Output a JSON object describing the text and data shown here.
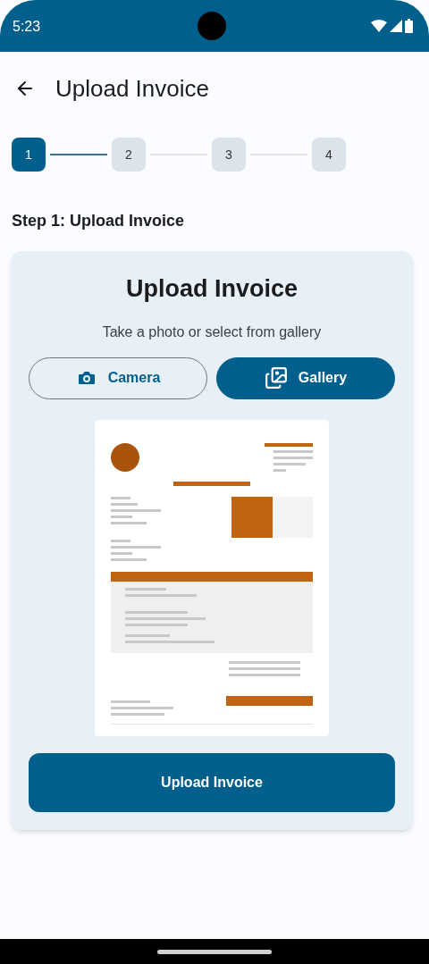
{
  "status_bar": {
    "time": "5:23"
  },
  "app_bar": {
    "title": "Upload Invoice"
  },
  "stepper": [
    {
      "label": "1",
      "selected": true
    },
    {
      "label": "2",
      "selected": false
    },
    {
      "label": "3",
      "selected": false
    },
    {
      "label": "4",
      "selected": false
    }
  ],
  "step_heading": "Step 1: Upload Invoice",
  "card": {
    "title": "Upload Invoice",
    "subtitle": "Take a photo or select from gallery",
    "buttons": [
      {
        "label": "Camera",
        "kind": "outlined"
      },
      {
        "label": "Gallery",
        "kind": "filled"
      }
    ],
    "upload_button": "Upload Invoice"
  }
}
